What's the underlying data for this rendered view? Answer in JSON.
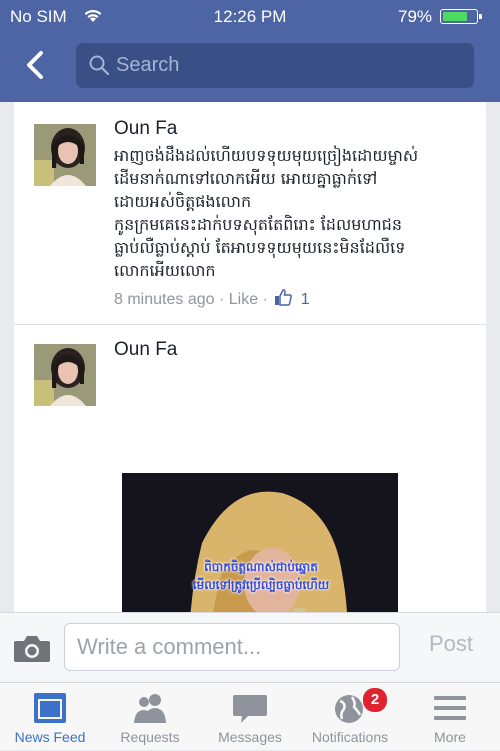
{
  "status_bar": {
    "carrier": "No SIM",
    "time": "12:26 PM",
    "battery_percent": "79%",
    "battery_level": 0.79
  },
  "header": {
    "back_icon": "chevron-left-icon",
    "search_placeholder": "Search"
  },
  "posts": [
    {
      "author": "Oun Fa",
      "text_lines": [
        "អាញចង់ដឹងដល់ហើយបទទុយមុយច្រៀងដោយម្ចាស់",
        "ដើមនាក់ណាទៅលោកអើយ  អោយគ្នាធ្លាក់ទៅ",
        "ដោយអស់ចិត្តផងលោក",
        "កូនក្រមគេនេះដាក់បទសុតតែពិរោះ  ដែលមហាជន",
        "ធ្លាប់លឺធ្លាប់ស្ដាប់  តែអាបទទុយមុយនេះមិនដែលឺទេ",
        "លោកអើយលោក"
      ],
      "timestamp": "8 minutes ago",
      "like_label": "Like",
      "like_count": "1"
    },
    {
      "author": "Oun Fa",
      "photo_caption_lines": [
        "ពិបាកចិត្តណាស់ជាប់ឆ្នោត",
        "មើលទៅត្រូវប្រើល្បិចធ្លាប់ហើយ"
      ]
    }
  ],
  "comment_bar": {
    "camera_icon": "camera-icon",
    "placeholder": "Write a comment...",
    "post_label": "Post"
  },
  "tabs": [
    {
      "label": "News Feed",
      "icon": "news-feed-icon",
      "active": true
    },
    {
      "label": "Requests",
      "icon": "friends-icon"
    },
    {
      "label": "Messages",
      "icon": "chat-bubble-icon"
    },
    {
      "label": "Notifications",
      "icon": "globe-icon",
      "badge": "2"
    },
    {
      "label": "More",
      "icon": "hamburger-icon"
    }
  ],
  "colors": {
    "brand_blue": "#4d65a5",
    "active_tab": "#3b71c9",
    "badge_red": "#e0242f",
    "battery_green": "#4cd964"
  }
}
